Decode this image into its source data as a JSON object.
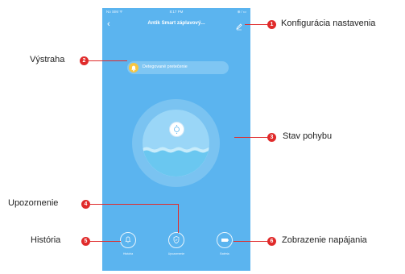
{
  "status_bar": {
    "carrier": "No SIM ᯤ",
    "time": "8:17 PM",
    "icons": "⊕ ⁄ ▭"
  },
  "header": {
    "title": "Antik Smart záplavový...",
    "back_icon": "chevron-left-icon",
    "edit_icon": "pencil-icon"
  },
  "alert": {
    "text": "Detegované pretečenie",
    "icon": "bell-icon",
    "color": "#f6c642"
  },
  "status": {
    "icon": "sensor-icon"
  },
  "bottom_nav": [
    {
      "label": "História",
      "icon": "bell-icon"
    },
    {
      "label": "Upozornenie",
      "icon": "shield-icon"
    },
    {
      "label": "Batéria",
      "icon": "battery-icon"
    }
  ],
  "callouts": [
    {
      "number": "1",
      "label": "Konfigurácia nastavenia"
    },
    {
      "number": "2",
      "label": "Výstraha"
    },
    {
      "number": "3",
      "label": "Stav pohybu"
    },
    {
      "number": "4",
      "label": "Upozornenie"
    },
    {
      "number": "5",
      "label": "História"
    },
    {
      "number": "6",
      "label": "Zobrazenie napájania"
    }
  ],
  "colors": {
    "background": "#5bb4ef",
    "callout": "#e02b2b",
    "alert_icon": "#f6c642"
  }
}
